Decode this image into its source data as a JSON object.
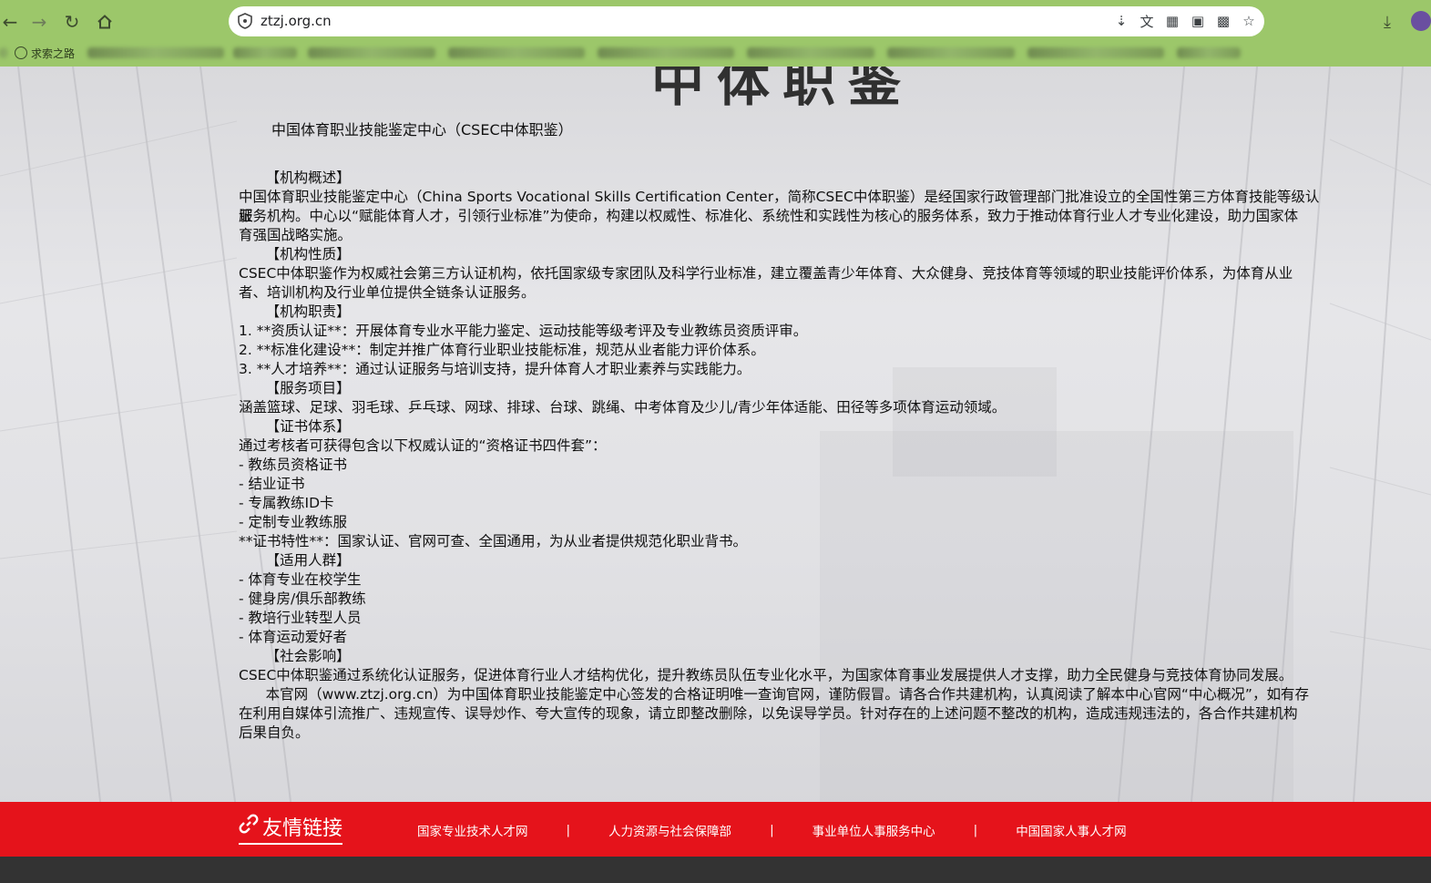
{
  "browser": {
    "url": "ztzj.org.cn",
    "bookmarks": {
      "first_visible": "求索之路"
    }
  },
  "page": {
    "hero_title": "中体职鉴",
    "subtitle": "中国体育职业技能鉴定中心（CSEC中体职鉴）",
    "lines": [
      "      【机构概述】",
      "中国体育职业技能鉴定中心（China Sports Vocational Skills Certification Center，简称CSEC中体职鉴）是经国家行政管理部门批准设立的全国性第三方体育技能等级认证",
      "服务机构。中心以“赋能体育人才，引领行业标准”为使命，构建以权威性、标准化、系统性和实践性为核心的服务体系，致力于推动体育行业人才专业化建设，助力国家体",
      "育强国战略实施。",
      "      【机构性质】",
      "CSEC中体职鉴作为权威社会第三方认证机构，依托国家级专家团队及科学行业标准，建立覆盖青少年体育、大众健身、竞技体育等领域的职业技能评价体系，为体育从业",
      "者、培训机构及行业单位提供全链条认证服务。",
      "      【机构职责】",
      "1. **资质认证**：开展体育专业水平能力鉴定、运动技能等级考评及专业教练员资质评审。",
      "2. **标准化建设**：制定并推广体育行业职业技能标准，规范从业者能力评价体系。",
      "3. **人才培养**：通过认证服务与培训支持，提升体育人才职业素养与实践能力。",
      "      【服务项目】",
      "涵盖篮球、足球、羽毛球、乒乓球、网球、排球、台球、跳绳、中考体育及少儿/青少年体适能、田径等多项体育运动领域。",
      "      【证书体系】",
      "通过考核者可获得包含以下权威认证的“资格证书四件套”：",
      "- 教练员资格证书",
      "- 结业证书",
      "- 专属教练ID卡",
      "- 定制专业教练服",
      "**证书特性**：国家认证、官网可查、全国通用，为从业者提供规范化职业背书。",
      "      【适用人群】",
      "- 体育专业在校学生",
      "- 健身房/俱乐部教练",
      "- 教培行业转型人员",
      "- 体育运动爱好者",
      "      【社会影响】",
      "CSEC中体职鉴通过系统化认证服务，促进体育行业人才结构优化，提升教练员队伍专业化水平，为国家体育事业发展提供人才支撑，助力全民健身与竞技体育协同发展。",
      "      本官网（www.ztzj.org.cn）为中国体育职业技能鉴定中心签发的合格证明唯一查询官网，谨防假冒。请各合作共建机构，认真阅读了解本中心官网“中心概况”，如有存",
      "在利用自媒体引流推广、违规宣传、误导炒作、夸大宣传的现象，请立即整改删除，以免误导学员。针对存在的上述问题不整改的机构，造成违规违法的，各合作共建机构",
      "后果自负。"
    ]
  },
  "footer": {
    "title": "友情链接",
    "links": [
      "国家专业技术人才网",
      "人力资源与社会保障部",
      "事业单位人事服务中心",
      "中国国家人事人才网"
    ],
    "separator": "|",
    "colors": {
      "bar": "#e5131b",
      "bottom": "#333333"
    }
  },
  "colors": {
    "chrome": "#9cc76a"
  }
}
